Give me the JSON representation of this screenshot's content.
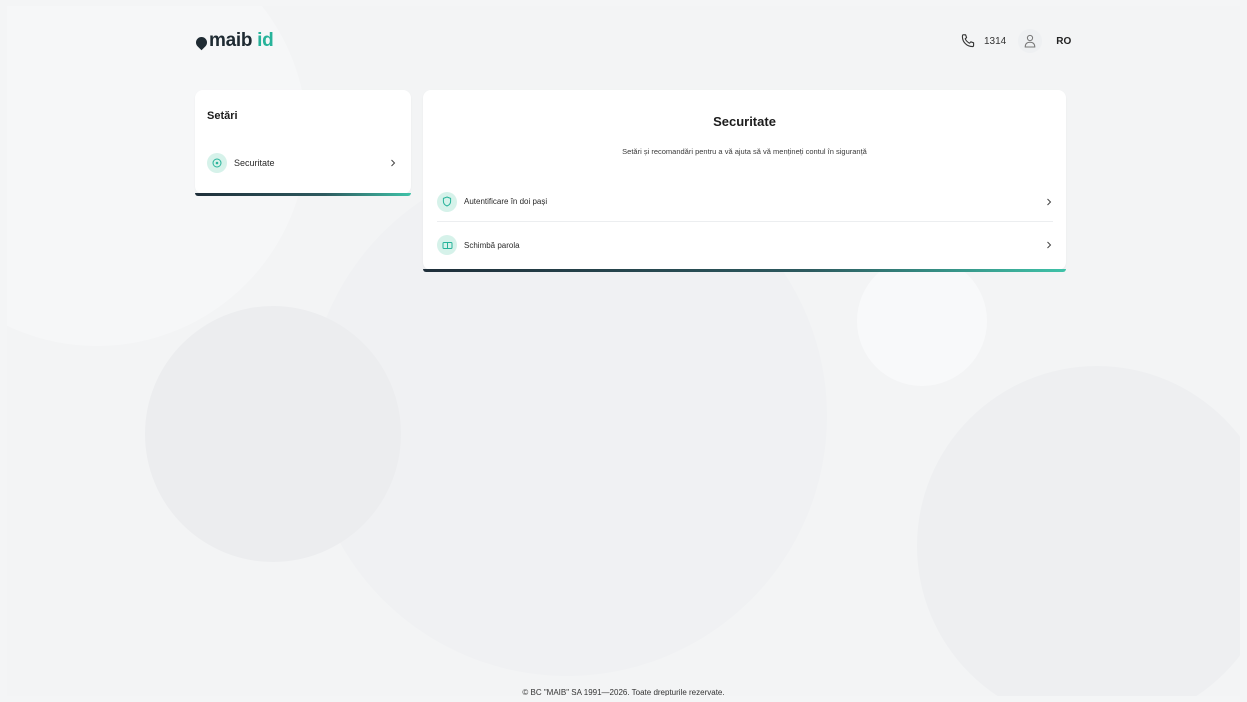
{
  "header": {
    "logo_brand": "maib",
    "logo_id": "id",
    "phone_number": "1314",
    "language": "RO"
  },
  "sidebar": {
    "title": "Setări",
    "items": [
      {
        "label": "Securitate",
        "icon": "lock-circle-icon"
      }
    ]
  },
  "main": {
    "title": "Securitate",
    "subtitle": "Setări și recomandări pentru a vă ajuta să vă mențineți contul în siguranță",
    "items": [
      {
        "label": "Autentificare în doi pași",
        "icon": "shield-icon"
      },
      {
        "label": "Schimbă parola",
        "icon": "key-icon"
      }
    ]
  },
  "footer": {
    "copyright": "© BC \"MAIB\" SA 1991—2026. Toate drepturile rezervate."
  },
  "colors": {
    "accent": "#27b39a",
    "icon_bg": "#d6f2ea",
    "dark": "#1f2b33"
  }
}
